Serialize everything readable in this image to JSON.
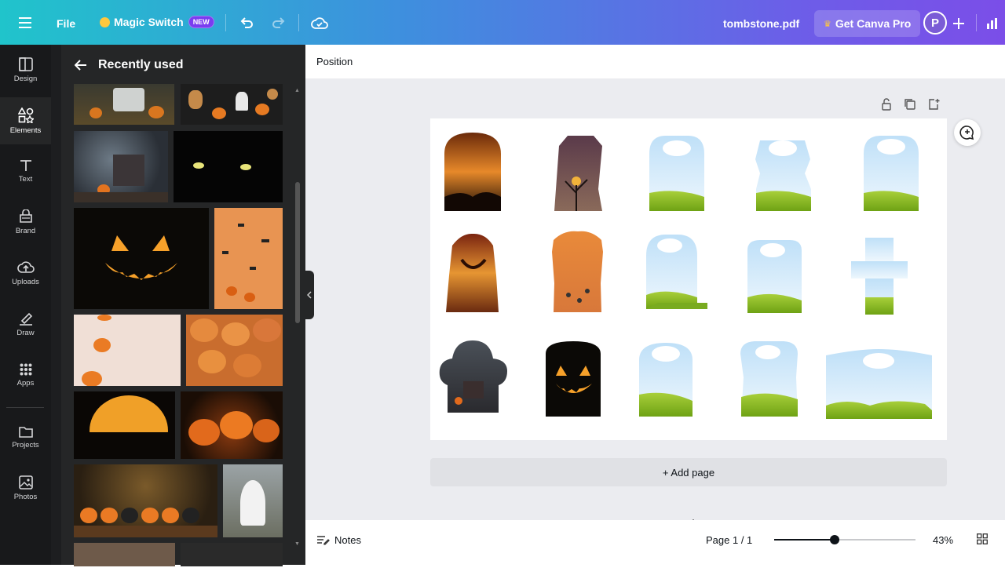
{
  "topbar": {
    "file_label": "File",
    "magic_switch_label": "Magic Switch",
    "new_badge": "NEW",
    "document_title": "tombstone.pdf",
    "get_pro_label": "Get Canva Pro",
    "avatar_initial": "P"
  },
  "rail": {
    "items": [
      {
        "label": "Design",
        "icon": "design-icon"
      },
      {
        "label": "Elements",
        "icon": "elements-icon"
      },
      {
        "label": "Text",
        "icon": "text-icon"
      },
      {
        "label": "Brand",
        "icon": "brand-icon"
      },
      {
        "label": "Uploads",
        "icon": "uploads-icon"
      },
      {
        "label": "Draw",
        "icon": "draw-icon"
      },
      {
        "label": "Apps",
        "icon": "apps-icon"
      },
      {
        "label": "Projects",
        "icon": "folder-icon"
      },
      {
        "label": "Photos",
        "icon": "photos-icon"
      }
    ],
    "active": "Elements"
  },
  "panel": {
    "title": "Recently used"
  },
  "toolbar": {
    "position_label": "Position"
  },
  "canvas": {
    "add_page_label": "+ Add page"
  },
  "bottom": {
    "notes_label": "Notes",
    "page_indicator": "Page 1 / 1",
    "zoom_level": "43%",
    "zoom_fraction": 0.43
  },
  "colors": {
    "accent": "#8b3dff",
    "sky": "#d6ecfb",
    "grass": "#8dbb1f",
    "pumpkin": "#e8762a"
  }
}
